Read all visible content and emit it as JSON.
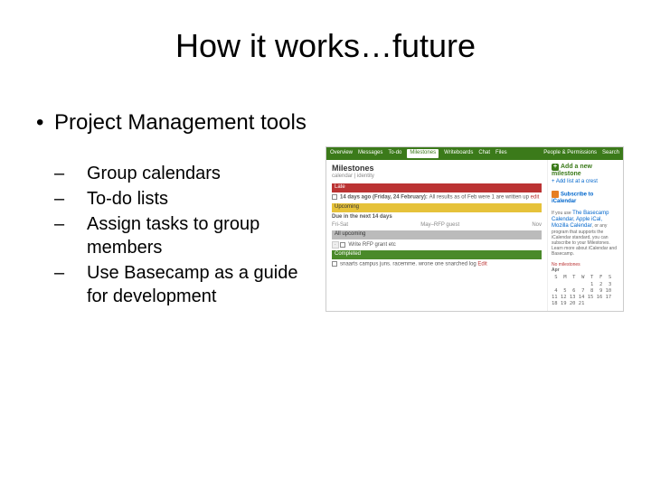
{
  "title": "How it works…future",
  "bullet_main": "Project Management tools",
  "sub_bullets": [
    "Group calendars",
    "To-do lists",
    "Assign tasks to group members",
    "Use Basecamp as a guide for development"
  ],
  "thumb": {
    "nav": {
      "items": [
        "Overview",
        "Messages",
        "To-do",
        "Milestones",
        "Writeboards",
        "Chat",
        "Files"
      ],
      "right": [
        "People & Permissions",
        "Search"
      ],
      "active": "Milestones"
    },
    "milestones_heading": "Milestones",
    "milestones_sub": "calendar | identity",
    "late_bar": "Late",
    "late_line_prefix": "14 days ago (Friday, 24 February): ",
    "late_line_text": "All results as of Feb were 1 are written up ",
    "late_line_edit": "edit",
    "upcoming_bar": "Upcoming",
    "due_label": "Due in the next 14 days",
    "row_left": "Fri-Sat",
    "row_right": "May–RFP guest",
    "row_right2": "Nov",
    "allupcoming_bar": "All upcoming",
    "upcoming_item": "Write RFP grant etc",
    "completed_bar": "Completed",
    "completed_item": "snaarts campus juns. racemme. wrone one snarched log ",
    "completed_edit": "Edit",
    "side": {
      "add_milestone": "Add a new milestone",
      "add_list": "Add list at a crest",
      "subscribe": "Subscribe to iCalendar",
      "blurb_prefix": "If you use ",
      "blurb_links": "The Basecamp Calendar, Apple iCal, Mozilla Calendar",
      "blurb_rest": ", or any program that supports the iCalendar standard, you can subscribe to your Milestones. Learn more about iCalendar and Basecamp.",
      "no_ms": "No milestones",
      "cal_month": "Apr",
      "cal_grid": " S  M  T  W  T  F  S\n             1  2  3\n 4  5  6  7  8  9 10\n11 12 13 14 15 16 17\n18 19 20 21"
    }
  }
}
